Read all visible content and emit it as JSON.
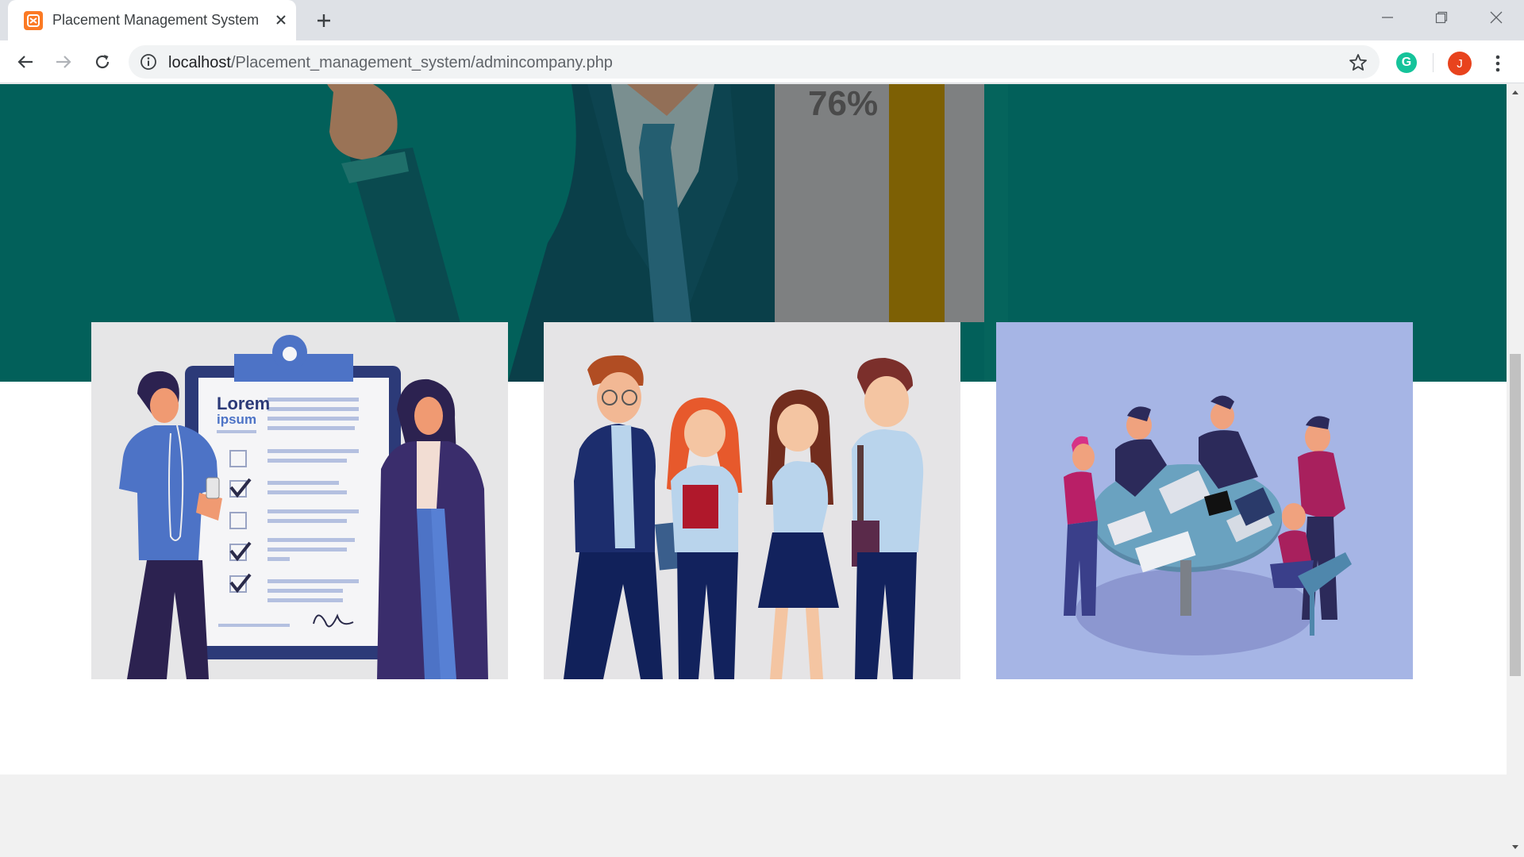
{
  "browser": {
    "tab_title": "Placement Management System",
    "url_host": "localhost",
    "url_path": "/Placement_management_system/admincompany.php",
    "profile_initial": "J",
    "grammarly_letter": "G",
    "icons": [
      "xampp-favicon-icon",
      "close-icon",
      "plus-icon",
      "minimize-icon",
      "restore-icon",
      "window-close-icon",
      "back-arrow-icon",
      "forward-arrow-icon",
      "reload-icon",
      "info-icon",
      "star-icon",
      "grammarly-icon",
      "kebab-menu-icon"
    ]
  },
  "hero": {
    "stat_text": "76%",
    "background_color": "#02605a"
  },
  "cards": [
    {
      "name": "clipboard-illustration",
      "heading": "Lorem",
      "subheading": "ipsum",
      "background_color": "#e6e6e7"
    },
    {
      "name": "students-illustration",
      "background_color": "#e5e4e6"
    },
    {
      "name": "meeting-illustration",
      "background_color": "#a6b5e5"
    }
  ]
}
